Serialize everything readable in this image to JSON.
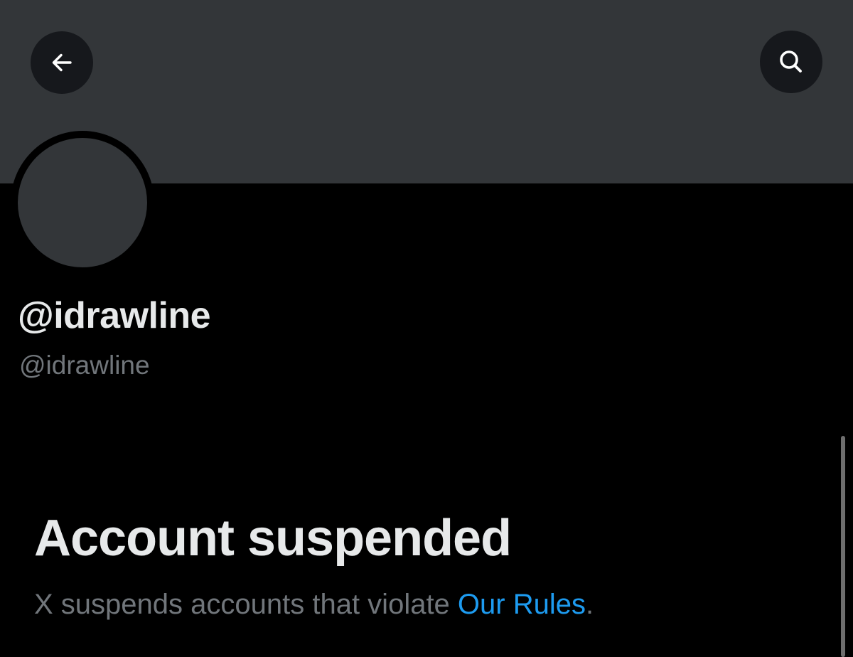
{
  "header": {
    "back_icon": "arrow-left-icon",
    "search_icon": "search-icon"
  },
  "profile": {
    "display_name": "@idrawline",
    "handle": "@idrawline"
  },
  "suspension": {
    "title": "Account suspended",
    "message_prefix": "X suspends accounts that violate ",
    "rules_link_text": "Our Rules",
    "message_suffix": "."
  },
  "colors": {
    "background": "#000000",
    "banner": "#333639",
    "primary_text": "#e7e9ea",
    "secondary_text": "#71767b",
    "link": "#1d9bf0"
  }
}
